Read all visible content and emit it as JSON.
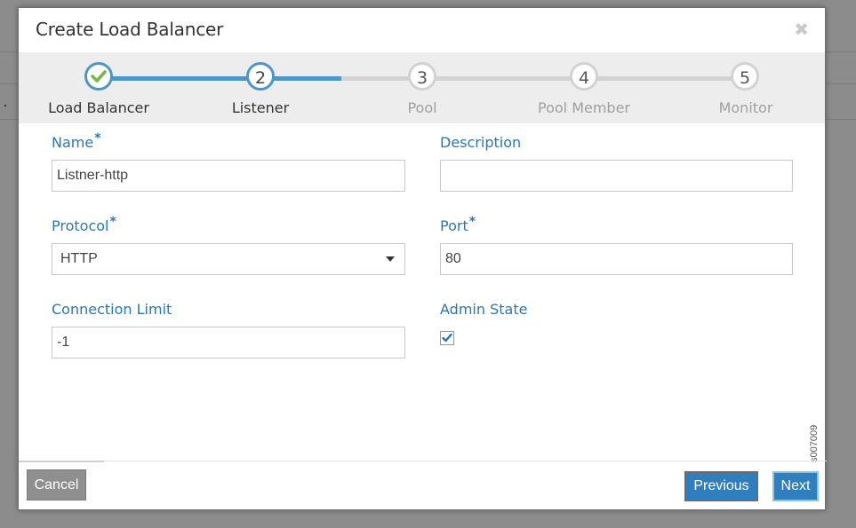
{
  "dialog": {
    "title": "Create Load Balancer",
    "close_symbol": "✖"
  },
  "wizard": {
    "steps": [
      {
        "number": "✔",
        "label": "Load Balancer",
        "state": "completed"
      },
      {
        "number": "2",
        "label": "Listener",
        "state": "active"
      },
      {
        "number": "3",
        "label": "Pool",
        "state": "pending"
      },
      {
        "number": "4",
        "label": "Pool Member",
        "state": "pending"
      },
      {
        "number": "5",
        "label": "Monitor",
        "state": "pending"
      }
    ]
  },
  "form": {
    "name": {
      "label": "Name",
      "required_mark": "*",
      "value": "Listner-http"
    },
    "description": {
      "label": "Description",
      "value": ""
    },
    "protocol": {
      "label": "Protocol",
      "required_mark": "*",
      "selected": "HTTP"
    },
    "port": {
      "label": "Port",
      "required_mark": "*",
      "value": "80"
    },
    "connection_limit": {
      "label": "Connection Limit",
      "value": "-1"
    },
    "admin_state": {
      "label": "Admin State",
      "checked": true
    }
  },
  "watermark": "s007009",
  "footer": {
    "cancel_label": "Cancel",
    "previous_label": "Previous",
    "next_label": "Next"
  },
  "colors": {
    "accent": "#2a77b5",
    "progress": "#4f95c6",
    "check": "#7ab648",
    "button": "#2f7fbf"
  }
}
